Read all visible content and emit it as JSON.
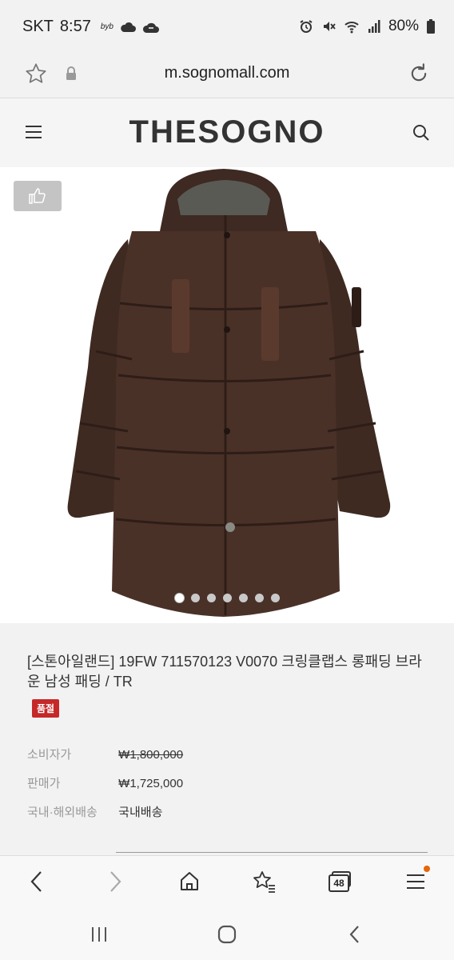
{
  "status_bar": {
    "carrier": "SKT",
    "time": "8:57",
    "small_label": "byb",
    "battery": "80%"
  },
  "browser": {
    "url": "m.sognomall.com",
    "icons": [
      "star-icon",
      "lock-icon",
      "reload-icon"
    ]
  },
  "site": {
    "logo": "THESOGNO",
    "icons": [
      "menu-icon",
      "search-icon"
    ]
  },
  "product": {
    "title": "[스톤아일랜드] 19FW 711570123 V0070 크링클랩스 롱패딩 브라운 남성 패딩 / TR",
    "badge": "품절",
    "image_count": 7,
    "active_image": 1,
    "rows": [
      {
        "label": "소비자가",
        "value": "₩1,800,000"
      },
      {
        "label": "판매가",
        "value": "₩1,725,000"
      },
      {
        "label": "국내·해외배송",
        "value": "국내배송"
      }
    ]
  },
  "bottom_nav": {
    "tabs_count": "48",
    "icons": [
      "back-icon",
      "forward-icon",
      "home-icon",
      "bookmarks-icon",
      "tabs-icon",
      "menu-icon"
    ]
  },
  "colors": {
    "badge": "#c62828",
    "coat": "#4a3128"
  }
}
